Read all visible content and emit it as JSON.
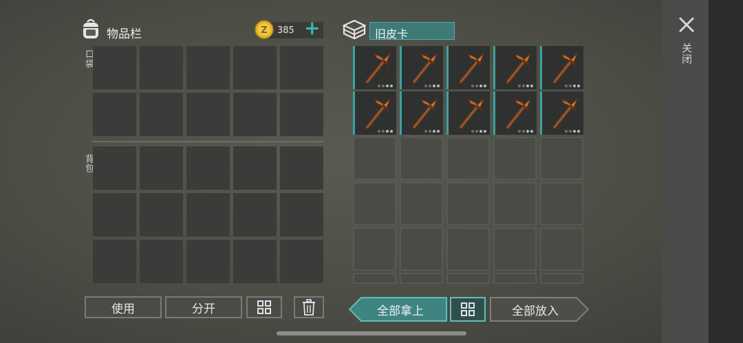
{
  "inventory": {
    "title": "物品栏",
    "coins": "385",
    "add_symbol": "+",
    "pocket_label": "口袋",
    "backpack_label": "背包"
  },
  "container": {
    "name": "旧皮卡",
    "item_name": "pickaxe"
  },
  "close": {
    "symbol": "✕",
    "label": "关闭"
  },
  "buttons": {
    "use": "使用",
    "split": "分开",
    "take_all": "全部拿上",
    "put_all": "全部放入"
  },
  "colors": {
    "accent": "#3aa3a0",
    "coin": "#e2b52b"
  }
}
